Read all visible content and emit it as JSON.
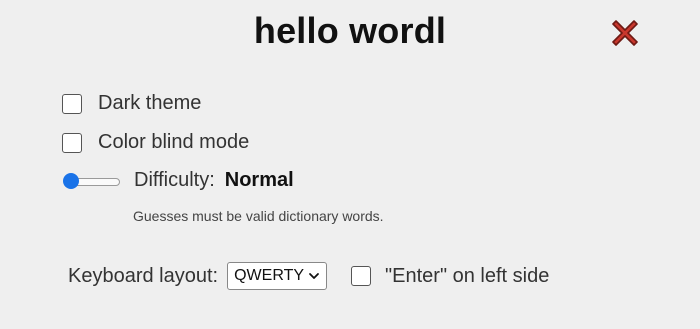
{
  "title": "hello wordl",
  "settings": {
    "dark_theme": {
      "label": "Dark theme",
      "checked": false
    },
    "color_blind": {
      "label": "Color blind mode",
      "checked": false
    },
    "difficulty": {
      "label": "Difficulty:",
      "value": "Normal",
      "level_fraction": 0,
      "hint": "Guesses must be valid dictionary words."
    },
    "keyboard": {
      "label": "Keyboard layout:",
      "selected": "QWERTY",
      "enter_left_label": "\"Enter\" on left side",
      "enter_left_checked": false
    }
  },
  "icons": {
    "close": "close-x-icon",
    "close_color": "#c8372d"
  },
  "colors": {
    "accent": "#1a73e8",
    "background": "#efefef"
  }
}
